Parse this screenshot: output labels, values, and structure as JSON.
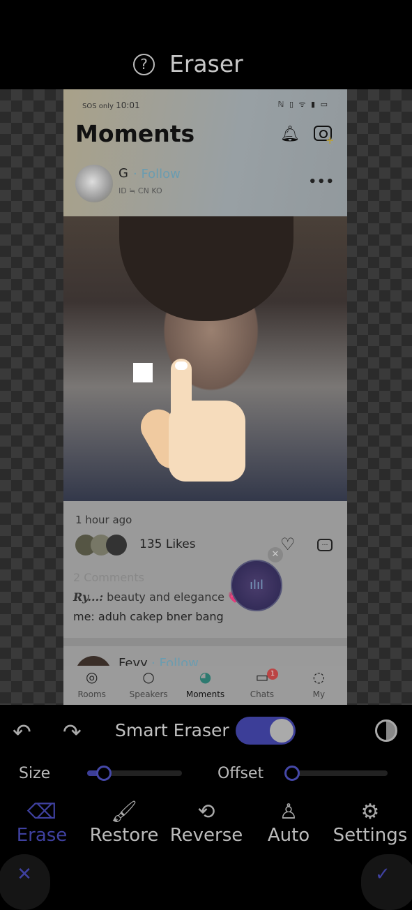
{
  "header": {
    "title": "Eraser",
    "help_icon": "question-circle-icon"
  },
  "screenshot": {
    "status": {
      "carrier": "SOS only",
      "time": "10:01",
      "right_icons": "ℕ ▯ ᯤ ▮ ▭"
    },
    "page_title": "Moments",
    "post": {
      "user": "G",
      "follow": "· Follow",
      "meta": "ID ≒ CN KO",
      "time_ago": "1 hour ago",
      "likes": "135 Likes",
      "comments_count": "2 Comments",
      "comments": [
        {
          "author": "Ry...:",
          "text": " beauty and elegance 💗✨"
        },
        {
          "author": "me:",
          "text": " aduh cakep bner bang"
        }
      ]
    },
    "next_post": {
      "user": "Fevy",
      "follow": "· Follow"
    },
    "tabs": [
      {
        "label": "Rooms",
        "icon": "◎"
      },
      {
        "label": "Speakers",
        "icon": "○"
      },
      {
        "label": "Moments",
        "icon": "◕"
      },
      {
        "label": "Chats",
        "icon": "▭"
      },
      {
        "label": "My",
        "icon": "◌"
      }
    ],
    "chats_badge": "1"
  },
  "toolbar": {
    "undo": "↶",
    "redo": "↷",
    "smart_eraser_label": "Smart Eraser",
    "smart_eraser_on": true,
    "size_label": "Size",
    "size_value": 0.18,
    "offset_label": "Offset",
    "offset_value": 0,
    "tools": [
      {
        "label": "Erase",
        "icon": "⌫",
        "active": true
      },
      {
        "label": "Restore",
        "icon": "🖌"
      },
      {
        "label": "Reverse",
        "icon": "⟲"
      },
      {
        "label": "Auto",
        "icon": "♙"
      },
      {
        "label": "Settings",
        "icon": "⚙"
      }
    ],
    "cancel": "✕",
    "confirm": "✓",
    "accent": "#3f41a0"
  }
}
